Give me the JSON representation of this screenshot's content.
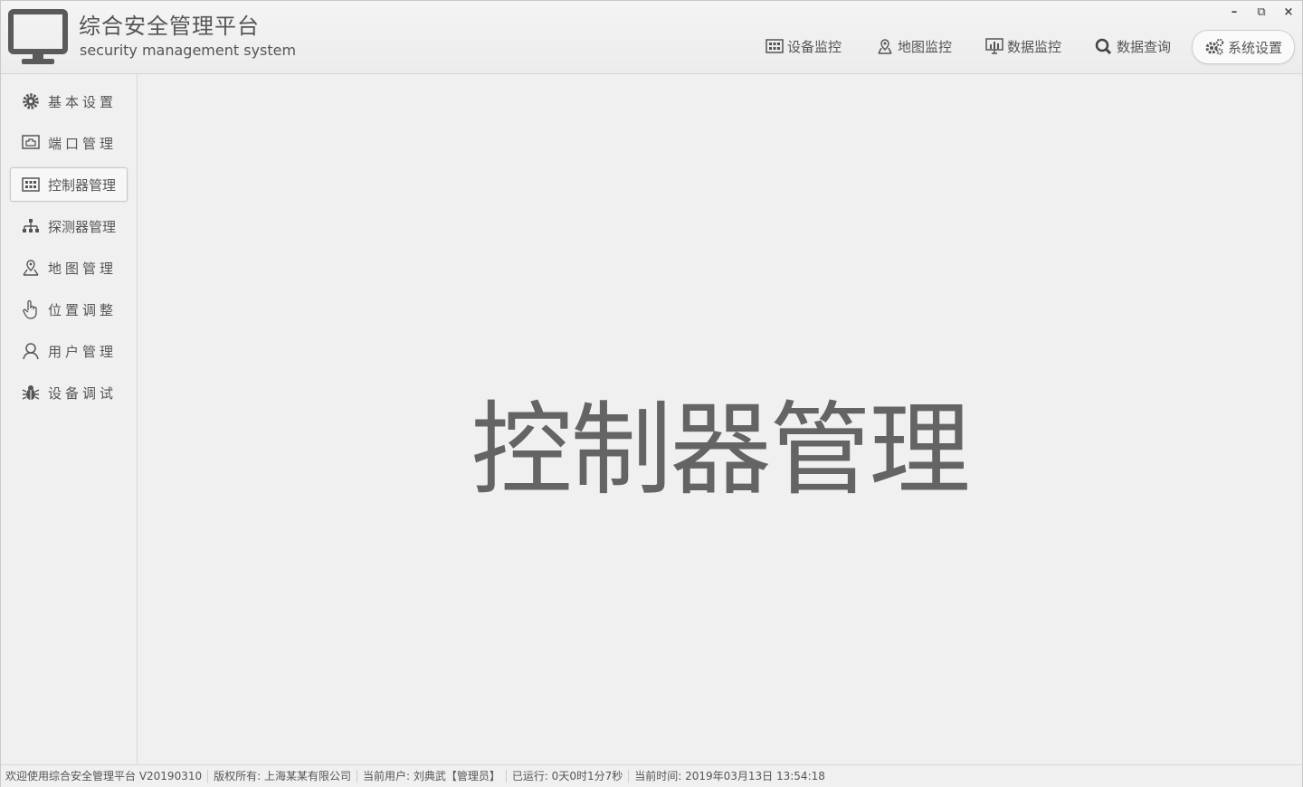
{
  "app": {
    "title": "综合安全管理平台",
    "subtitle": "security management system"
  },
  "window_controls": {
    "minimize": "–",
    "restore": "⧉",
    "close": "×"
  },
  "topnav": {
    "device_monitor": "设备监控",
    "map_monitor": "地图监控",
    "data_monitor": "数据监控",
    "data_query": "数据查询",
    "system_settings": "系统设置"
  },
  "sidebar": {
    "items": [
      {
        "label": "基本设置",
        "icon": "gear-icon"
      },
      {
        "label": "端口管理",
        "icon": "port-icon"
      },
      {
        "label": "控制器管理",
        "icon": "controller-icon",
        "active": true
      },
      {
        "label": "探测器管理",
        "icon": "hierarchy-icon"
      },
      {
        "label": "地图管理",
        "icon": "map-pin-icon"
      },
      {
        "label": "位置调整",
        "icon": "hand-pointer-icon"
      },
      {
        "label": "用户管理",
        "icon": "user-icon"
      },
      {
        "label": "设备调试",
        "icon": "bug-icon"
      }
    ]
  },
  "main": {
    "heading": "控制器管理"
  },
  "status": {
    "welcome": "欢迎使用综合安全管理平台 V20190310",
    "copyright": "版权所有: 上海某某有限公司",
    "user": "当前用户: 刘典武【管理员】",
    "uptime": "已运行: 0天0时1分7秒",
    "time": "当前时间: 2019年03月13日 13:54:18"
  },
  "colors": {
    "background": "#f0f0f0",
    "text": "#555555",
    "heading": "#646464",
    "border": "#c9c9c9"
  }
}
